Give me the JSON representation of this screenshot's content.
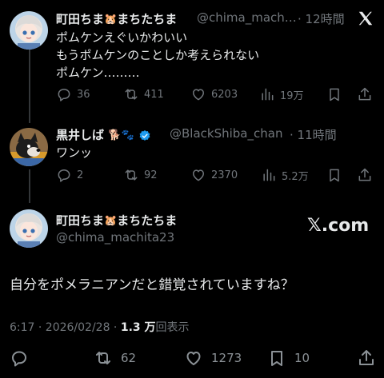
{
  "tweet1": {
    "display_name": "町田ちま",
    "display_name_suffix": "まちたちま",
    "handle": "@chima_mach…",
    "time": "· 12時間",
    "lines": [
      "ポムケンえぐいかわいい",
      "もうポムケンのことしか考えられない",
      "ポムケン………"
    ],
    "replies": "36",
    "reposts": "411",
    "likes": "6203",
    "views": "19万"
  },
  "tweet2": {
    "display_name": "黒井しば",
    "handle": "@BlackShiba_chan",
    "time": "· 11時間",
    "text": "ワンッ",
    "replies": "2",
    "reposts": "92",
    "likes": "2370",
    "views": "5.2万"
  },
  "main": {
    "display_name": "町田ちま",
    "display_name_suffix": "まちたちま",
    "handle": "@chima_machita23",
    "watermark": "𝕏.com",
    "text": "自分をポメラニアンだと錯覚されていますね？",
    "timestamp": "6:17 · 2026/02/28 · ",
    "views_count": "1.3 万",
    "views_label": "回表示",
    "reposts": "62",
    "likes": "1273",
    "bookmarks": "10"
  },
  "icons": {
    "reply": "reply-icon",
    "repost": "repost-icon",
    "like": "heart-icon",
    "views": "views-chart-icon",
    "bookmark": "bookmark-icon",
    "share": "share-icon",
    "x_logo": "x-logo-icon"
  },
  "colors": {
    "background": "#000000",
    "text": "#e7e9ea",
    "muted": "#71767b",
    "verified": "#1d9bf0"
  }
}
